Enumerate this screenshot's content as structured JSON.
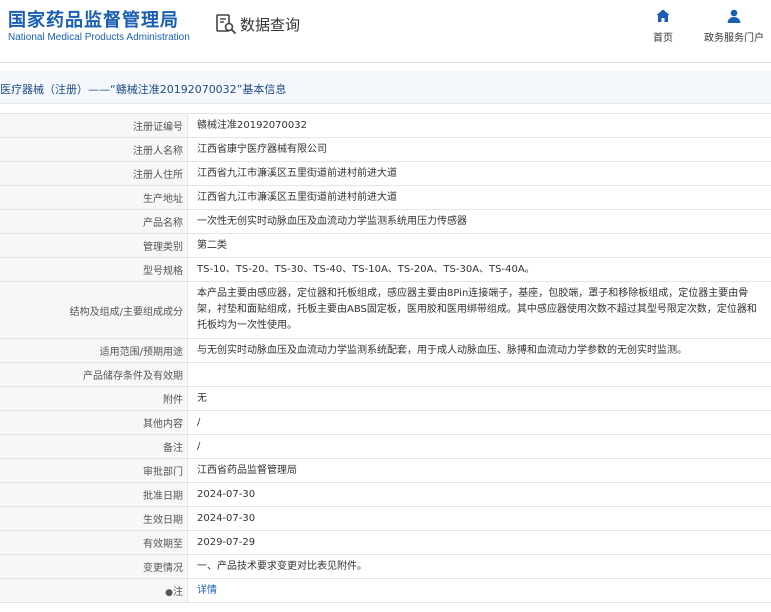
{
  "header": {
    "org_name_cn": "国家药品监督管理局",
    "org_name_en": "National Medical Products Administration",
    "search_label": "数据查询",
    "nav": [
      {
        "label": "首页",
        "icon": "home-icon"
      },
      {
        "label": "政务服务门户",
        "icon": "user-icon"
      }
    ]
  },
  "page": {
    "title": "医疗器械（注册）——“赣械注准20192070032”基本信息"
  },
  "colors": {
    "brand": "#1a5fb4",
    "title_text": "#1e4c86",
    "label_bg": "#f7f7f7",
    "title_bg": "#f4f8fc"
  },
  "rows": [
    {
      "label": "注册证编号",
      "value": "赣械注准20192070032"
    },
    {
      "label": "注册人名称",
      "value": "江西省康宁医疗器械有限公司"
    },
    {
      "label": "注册人住所",
      "value": "江西省九江市濂溪区五里街道前进村前进大道"
    },
    {
      "label": "生产地址",
      "value": "江西省九江市濂溪区五里街道前进村前进大道"
    },
    {
      "label": "产品名称",
      "value": "一次性无创实时动脉血压及血流动力学监测系统用压力传感器"
    },
    {
      "label": "管理类别",
      "value": "第二类"
    },
    {
      "label": "型号规格",
      "value": "TS-10、TS-20、TS-30、TS-40、TS-10A、TS-20A、TS-30A、TS-40A。"
    },
    {
      "label": "结构及组成/主要组成成分",
      "value": "本产品主要由感应器，定位器和托板组成，感应器主要由8Pin连接端子，基座，包胶端，罩子和移除板组成，定位器主要由骨架，衬垫和面贴组成，托板主要由ABS固定板，医用胶和医用绑带组成。其中感应器使用次数不超过其型号限定次数，定位器和托板均为一次性使用。"
    },
    {
      "label": "适用范围/预期用途",
      "value": "与无创实时动脉血压及血流动力学监测系统配套，用于成人动脉血压、脉搏和血流动力学参数的无创实时监测。"
    },
    {
      "label": "产品储存条件及有效期",
      "value": ""
    },
    {
      "label": "附件",
      "value": "无"
    },
    {
      "label": "其他内容",
      "value": "/"
    },
    {
      "label": "备注",
      "value": "/"
    },
    {
      "label": "审批部门",
      "value": "江西省药品监督管理局"
    },
    {
      "label": "批准日期",
      "value": "2024-07-30"
    },
    {
      "label": "生效日期",
      "value": "2024-07-30"
    },
    {
      "label": "有效期至",
      "value": "2029-07-29"
    },
    {
      "label": "变更情况",
      "value": "一、产品技术要求变更对比表见附件。"
    },
    {
      "label": "注",
      "value": "详情",
      "icon": "pin-icon"
    }
  ]
}
